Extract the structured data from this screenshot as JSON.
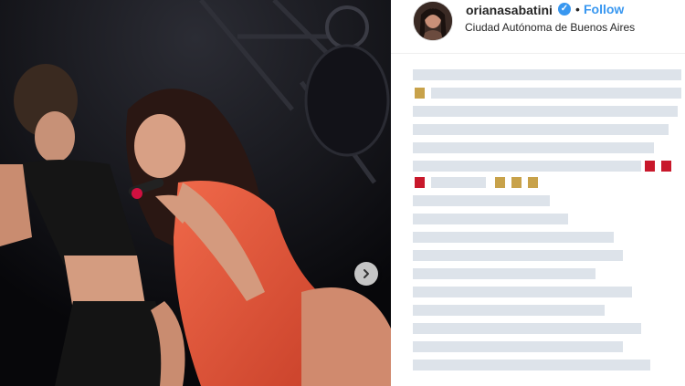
{
  "post": {
    "username": "orianasabatini",
    "follow_label": "Follow",
    "separator": "•",
    "location": "Ciudad Autónoma de Buenos Aires",
    "verified_icon": "verified-badge-icon"
  },
  "carousel": {
    "next_icon": "chevron-right-icon"
  },
  "colors": {
    "brand_blue": "#3897f0",
    "text_dark": "#262626"
  }
}
